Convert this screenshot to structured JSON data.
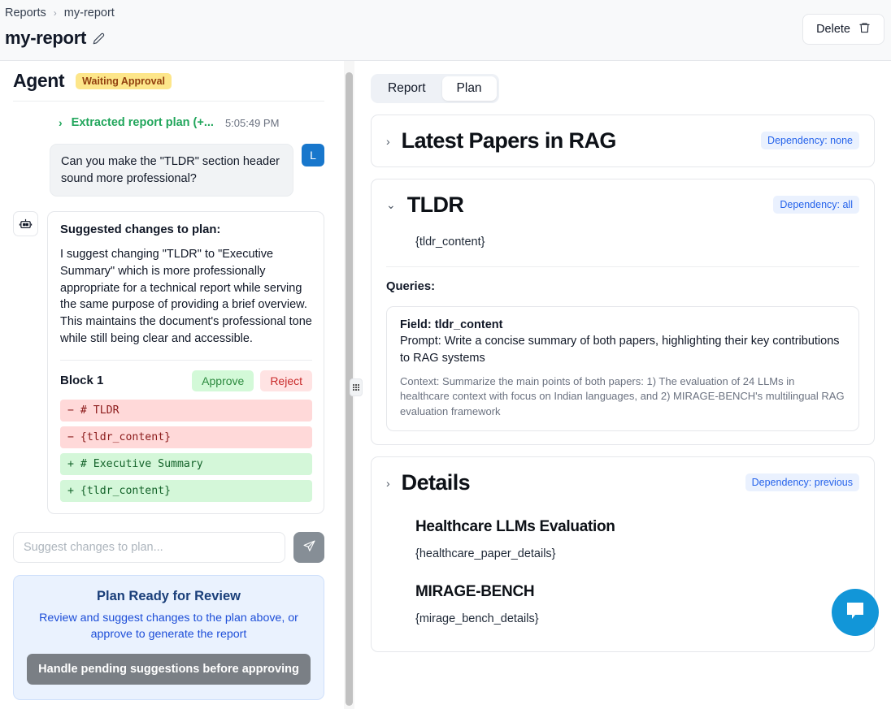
{
  "topbar": {
    "breadcrumb": {
      "parent": "Reports",
      "separator": "›",
      "current": "my-report"
    },
    "page_title": "my-report",
    "edit_icon": "pencil-icon",
    "delete_label": "Delete",
    "delete_icon": "trash-icon"
  },
  "agent": {
    "title": "Agent",
    "status": "Waiting Approval",
    "refresh_icon": "refresh-icon",
    "plan_entry": {
      "chevron": "›",
      "label": "Extracted report plan (+...",
      "time": "5:05:49 PM"
    },
    "user_message": {
      "text": "Can you make the \"TLDR\" section header sound more professional?",
      "avatar": "L"
    },
    "suggestion": {
      "bot_icon": "robot-icon",
      "heading": "Suggested changes to plan:",
      "body": "I suggest changing \"TLDR\" to \"Executive Summary\" which is more professionally appropriate for a technical report while serving the same purpose of providing a brief overview. This maintains the document's professional tone while still being clear and accessible.",
      "block_label": "Block 1",
      "approve_label": "Approve",
      "reject_label": "Reject",
      "diff": [
        {
          "type": "del",
          "text": "− # TLDR"
        },
        {
          "type": "del",
          "text": "− {tldr_content}"
        },
        {
          "type": "add",
          "text": "+ # Executive Summary"
        },
        {
          "type": "add",
          "text": "+ {tldr_content}"
        }
      ]
    },
    "composer": {
      "placeholder": "Suggest changes to plan...",
      "value": "",
      "send_icon": "send-icon"
    },
    "approval": {
      "title": "Plan Ready for Review",
      "subtitle": "Review and suggest changes to the plan above, or approve to generate the report",
      "button_label": "Handle pending suggestions before approving"
    }
  },
  "plan_panel": {
    "tabs": [
      {
        "label": "Report",
        "active": false
      },
      {
        "label": "Plan",
        "active": true
      }
    ],
    "sections": [
      {
        "chevron": "›",
        "title": "Latest Papers in RAG",
        "dependency": "Dependency: none",
        "expanded": false
      },
      {
        "chevron": "⌄",
        "title": "TLDR",
        "dependency": "Dependency: all",
        "expanded": true,
        "placeholder": "{tldr_content}",
        "queries_label": "Queries:",
        "query": {
          "field": "Field: tldr_content",
          "prompt": "Prompt: Write a concise summary of both papers, highlighting their key contributions to RAG systems",
          "context": "Context: Summarize the main points of both papers: 1) The evaluation of 24 LLMs in healthcare context with focus on Indian languages, and 2) MIRAGE-BENCH's multilingual RAG evaluation framework"
        }
      },
      {
        "chevron": "›",
        "title": "Details",
        "dependency": "Dependency: previous",
        "expanded": false,
        "details": [
          {
            "heading": "Healthcare LLMs Evaluation",
            "value": "{healthcare_paper_details}"
          },
          {
            "heading": "MIRAGE-BENCH",
            "value": "{mirage_bench_details}"
          }
        ]
      }
    ],
    "chat_fab_icon": "chat-bubble-icon"
  },
  "colors": {
    "accent_blue": "#2563eb",
    "badge_yellow": "#fde68a",
    "diff_add_bg": "#d4f7d9",
    "diff_del_bg": "#ffd9d9",
    "fab_blue": "#1296d8"
  }
}
